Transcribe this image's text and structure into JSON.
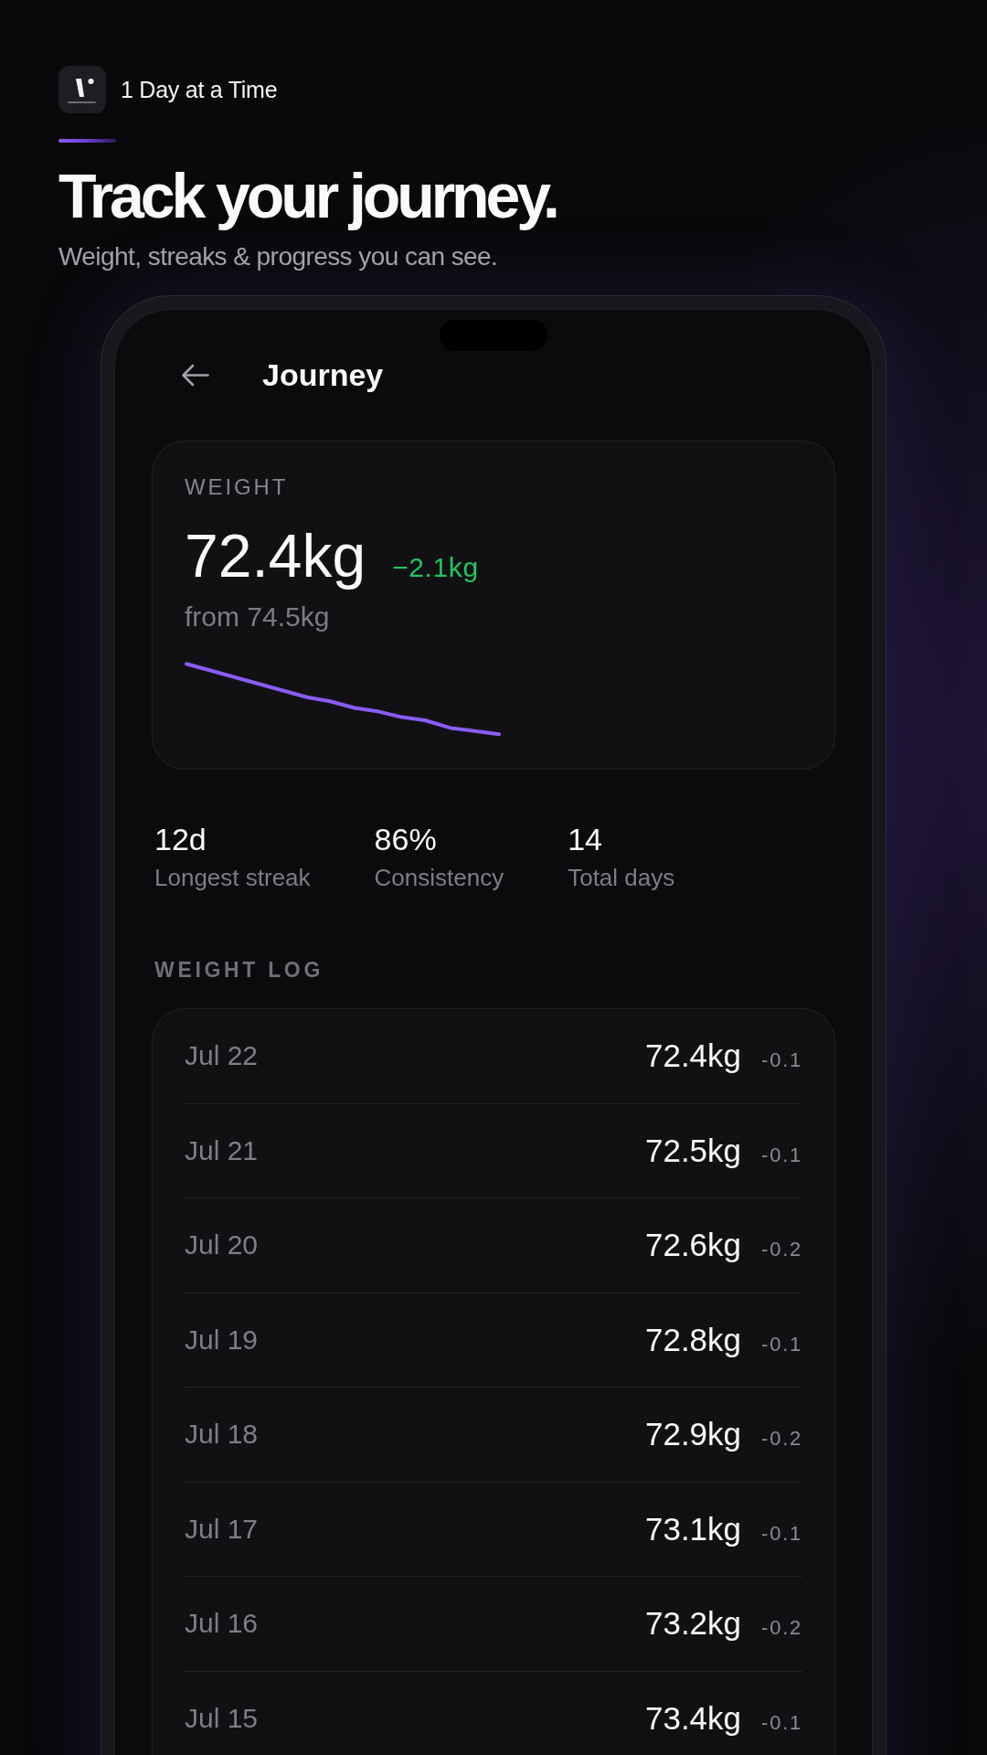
{
  "brand": {
    "name": "1 Day at a Time"
  },
  "hero": {
    "title": "Track your journey.",
    "subtitle": "Weight, streaks & progress you can see."
  },
  "screen": {
    "title": "Journey"
  },
  "weight_card": {
    "label": "WEIGHT",
    "current": "72.4kg",
    "change": "−2.1kg",
    "start": "from 74.5kg"
  },
  "stats": [
    {
      "value": "12d",
      "label": "Longest streak"
    },
    {
      "value": "86%",
      "label": "Consistency"
    },
    {
      "value": "14",
      "label": "Total days"
    }
  ],
  "weight_log": {
    "title": "WEIGHT LOG",
    "entries": [
      {
        "date": "Jul 22",
        "weight": "72.4kg",
        "delta": "-0.1"
      },
      {
        "date": "Jul 21",
        "weight": "72.5kg",
        "delta": "-0.1"
      },
      {
        "date": "Jul 20",
        "weight": "72.6kg",
        "delta": "-0.2"
      },
      {
        "date": "Jul 19",
        "weight": "72.8kg",
        "delta": "-0.1"
      },
      {
        "date": "Jul 18",
        "weight": "72.9kg",
        "delta": "-0.2"
      },
      {
        "date": "Jul 17",
        "weight": "73.1kg",
        "delta": "-0.1"
      },
      {
        "date": "Jul 16",
        "weight": "73.2kg",
        "delta": "-0.2"
      },
      {
        "date": "Jul 15",
        "weight": "73.4kg",
        "delta": "-0.1"
      }
    ]
  }
}
